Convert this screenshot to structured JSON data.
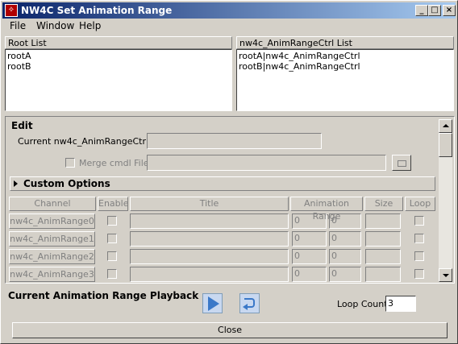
{
  "window": {
    "title": "NW4C Set Animation Range",
    "controls": {
      "minimize": "_",
      "maximize": "□",
      "close": "×"
    }
  },
  "menu": [
    "File",
    "Window",
    "Help"
  ],
  "root_list": {
    "header": "Root List",
    "items": [
      "rootA",
      "rootB"
    ]
  },
  "anim_ctrl_list": {
    "header": "nw4c_AnimRangeCtrl List",
    "items": [
      "rootA|nw4c_AnimRangeCtrl",
      "rootB|nw4c_AnimRangeCtrl"
    ]
  },
  "edit": {
    "title": "Edit",
    "current_label": "Current nw4c_AnimRangeCtrl  :",
    "current_value": "",
    "merge_label": "Merge cmdl File",
    "merge_value": "",
    "merge_checked": false,
    "custom_options_label": "Custom Options",
    "columns": [
      "Channel",
      "Enable",
      "Title",
      "Animation Range",
      "Size",
      "Loop"
    ],
    "rows": [
      {
        "channel": "nw4c_AnimRange0",
        "title": "",
        "start": "0",
        "end": "0",
        "size": ""
      },
      {
        "channel": "nw4c_AnimRange1",
        "title": "",
        "start": "0",
        "end": "0",
        "size": ""
      },
      {
        "channel": "nw4c_AnimRange2",
        "title": "",
        "start": "0",
        "end": "0",
        "size": ""
      },
      {
        "channel": "nw4c_AnimRange3",
        "title": "",
        "start": "0",
        "end": "0",
        "size": ""
      }
    ]
  },
  "playback": {
    "title": "Current Animation Range Playback",
    "loop_count_label": "Loop Count",
    "loop_count": "3"
  },
  "close_label": "Close"
}
